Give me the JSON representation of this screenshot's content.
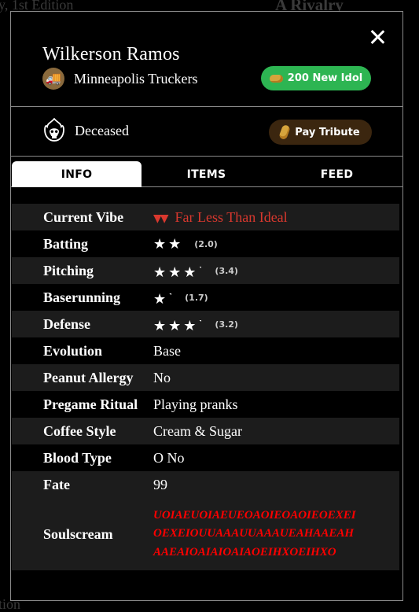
{
  "background": {
    "top_left": "y, 1st Edition",
    "top_center": "A Rivalry",
    "bottom_left": "tion"
  },
  "header": {
    "player_name": "Wilkerson Ramos",
    "team_name": "Minneapolis Truckers",
    "team_emoji": "🚚",
    "idol_button": "200 New Idol"
  },
  "status": {
    "label": "Deceased",
    "tribute_button": "Pay Tribute"
  },
  "tabs": [
    {
      "label": "INFO",
      "active": true
    },
    {
      "label": "ITEMS",
      "active": false
    },
    {
      "label": "FEED",
      "active": false
    }
  ],
  "attributes": {
    "vibe_label": "Current Vibe",
    "vibe_value": "Far Less Than Ideal",
    "batting_label": "Batting",
    "batting_rating": "(2.0)",
    "batting_stars": 2.0,
    "pitching_label": "Pitching",
    "pitching_rating": "(3.4)",
    "pitching_stars": 3.4,
    "baserunning_label": "Baserunning",
    "baserunning_rating": "(1.7)",
    "baserunning_stars": 1.7,
    "defense_label": "Defense",
    "defense_rating": "(3.2)",
    "defense_stars": 3.2,
    "evolution_label": "Evolution",
    "evolution_value": "Base",
    "allergy_label": "Peanut Allergy",
    "allergy_value": "No",
    "ritual_label": "Pregame Ritual",
    "ritual_value": "Playing pranks",
    "coffee_label": "Coffee Style",
    "coffee_value": "Cream & Sugar",
    "blood_label": "Blood Type",
    "blood_value": "O No",
    "fate_label": "Fate",
    "fate_value": "99",
    "soulscream_label": "Soulscream",
    "soulscream_value": "UOIAEUOIAEUEOAOIEOAOIEOEXEIOEXEIOUUAAAUUAAAUEAHAAEAHAAEAIOAIAIOAIAOEIHXOEIHXO"
  },
  "colors": {
    "idol_green": "#2db552",
    "tribute_brown": "#3b260f",
    "vibe_red": "#d9382e",
    "soulscream_red": "#ff0000"
  },
  "icons": [
    "close-icon",
    "truck-icon",
    "peanut-icon",
    "skull-fire-icon",
    "double-down-arrow-icon",
    "star-icon"
  ]
}
